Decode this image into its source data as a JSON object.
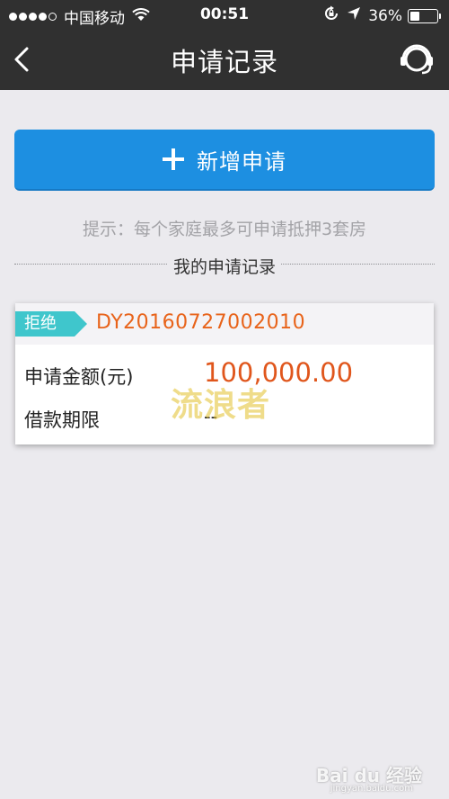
{
  "status_bar": {
    "carrier": "中国移动",
    "time": "00:51",
    "battery": "36%",
    "battery_level": 0.36
  },
  "nav": {
    "title": "申请记录",
    "back_icon": "chevron-left-icon",
    "service_icon": "headset-icon"
  },
  "actions": {
    "add_label": "新增申请"
  },
  "tip": "提示：每个家庭最多可申请抵押3套房",
  "section_title": "我的申请记录",
  "records": [
    {
      "status": "拒绝",
      "order_no": "DY20160727002010",
      "amount_label": "申请金额(元)",
      "amount": "100,000.00",
      "term_label": "借款期限",
      "term": "--"
    }
  ],
  "watermark": "流浪者",
  "baidu_watermark": "Bai du 经验",
  "baidu_sub": "jingyan.baidu.com",
  "colors": {
    "nav_bg": "#303030",
    "page_bg": "#ebeaee",
    "primary": "#1d8fe1",
    "status_tag": "#3fc6cc",
    "accent_orange": "#e8631a"
  }
}
